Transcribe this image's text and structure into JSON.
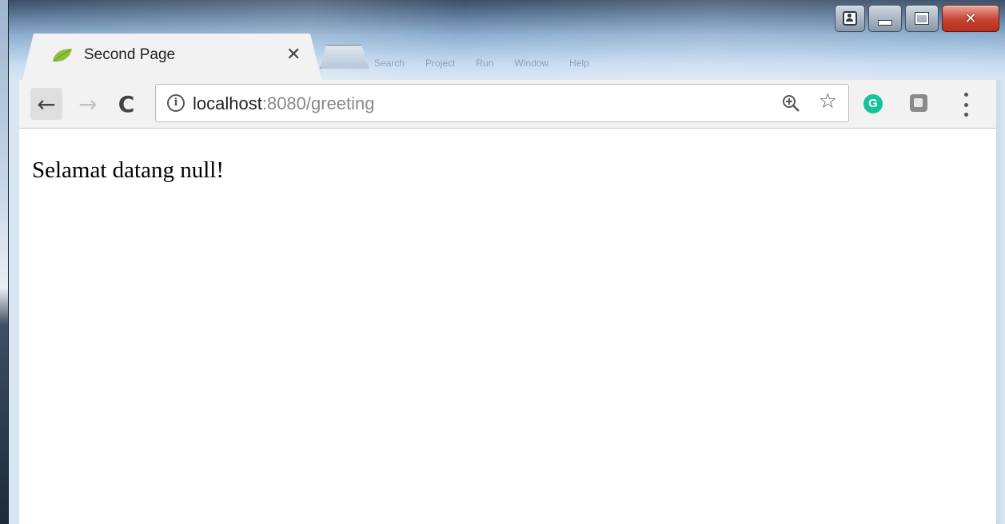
{
  "window": {
    "tab": {
      "title": "Second Page"
    },
    "ghost_menu": [
      "Search",
      "Project",
      "Run",
      "Window",
      "Help"
    ]
  },
  "toolbar": {
    "url_host": "localhost",
    "url_rest": ":8080/greeting"
  },
  "page": {
    "greeting": "Selamat datang null!"
  },
  "colors": {
    "favicon": "#8dbf3c",
    "grammarly": "#15c39a",
    "close_button": "#c7422f"
  },
  "icons": [
    "leaf-favicon-icon",
    "close-icon",
    "back-arrow-icon",
    "forward-arrow-icon",
    "reload-icon",
    "info-icon",
    "zoom-icon",
    "star-icon",
    "grammarly-icon",
    "extension-icon",
    "kebab-menu-icon",
    "user-icon",
    "minimize-icon",
    "maximize-icon",
    "window-close-icon"
  ]
}
